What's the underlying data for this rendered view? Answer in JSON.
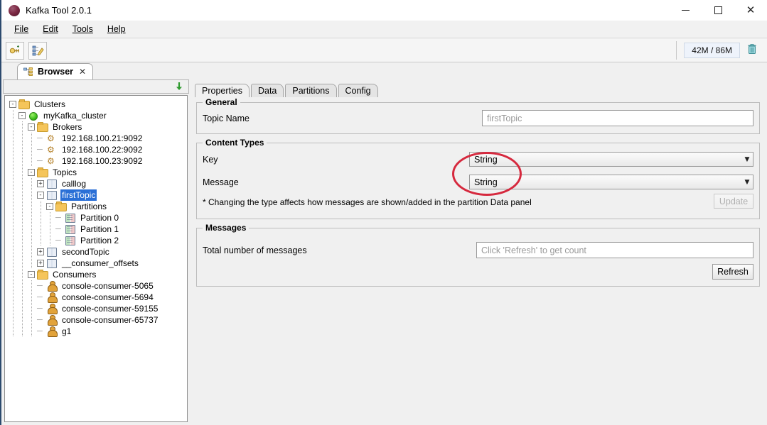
{
  "window": {
    "title": "Kafka Tool  2.0.1",
    "app_icon": "kafka-tool-logo",
    "minimize": "—",
    "maximize": "□",
    "close": "✕"
  },
  "menubar": {
    "items": [
      {
        "label": "File",
        "mnemonic": "F"
      },
      {
        "label": "Edit",
        "mnemonic": "E"
      },
      {
        "label": "Tools",
        "mnemonic": "T"
      },
      {
        "label": "Help",
        "mnemonic": "H"
      }
    ]
  },
  "toolbar": {
    "buttons": [
      {
        "name": "add-cluster-icon"
      },
      {
        "name": "edit-cluster-icon"
      }
    ],
    "memory": {
      "value": "42M / 86M",
      "trash_icon": "trash-icon"
    }
  },
  "tabstrip": {
    "browser_tab": {
      "label": "Browser",
      "icon": "browser-tree-icon",
      "close": "✕"
    }
  },
  "tree_header": {
    "collapse_icon": "green-down-arrow-icon"
  },
  "tree": {
    "nodes": [
      {
        "label": "Clusters",
        "indent": 0,
        "expander": "-",
        "icon": "folder-icon",
        "selected": false
      },
      {
        "label": "myKafka_cluster",
        "indent": 1,
        "expander": "-",
        "icon": "cluster-icon",
        "selected": false
      },
      {
        "label": "Brokers",
        "indent": 2,
        "expander": "-",
        "icon": "folder-icon",
        "selected": false
      },
      {
        "label": "192.168.100.21:9092",
        "indent": 3,
        "expander": "",
        "icon": "broker-icon",
        "selected": false
      },
      {
        "label": "192.168.100.22:9092",
        "indent": 3,
        "expander": "",
        "icon": "broker-icon",
        "selected": false
      },
      {
        "label": "192.168.100.23:9092",
        "indent": 3,
        "expander": "",
        "icon": "broker-icon",
        "selected": false
      },
      {
        "label": "Topics",
        "indent": 2,
        "expander": "-",
        "icon": "folder-icon",
        "selected": false
      },
      {
        "label": "calllog",
        "indent": 3,
        "expander": "+",
        "icon": "topic-icon",
        "selected": false
      },
      {
        "label": "firstTopic",
        "indent": 3,
        "expander": "-",
        "icon": "topic-icon",
        "selected": true
      },
      {
        "label": "Partitions",
        "indent": 4,
        "expander": "-",
        "icon": "folder-icon",
        "selected": false
      },
      {
        "label": "Partition 0",
        "indent": 5,
        "expander": "",
        "icon": "partition-icon",
        "selected": false
      },
      {
        "label": "Partition 1",
        "indent": 5,
        "expander": "",
        "icon": "partition-icon",
        "selected": false
      },
      {
        "label": "Partition 2",
        "indent": 5,
        "expander": "",
        "icon": "partition-icon",
        "selected": false
      },
      {
        "label": "secondTopic",
        "indent": 3,
        "expander": "+",
        "icon": "topic-icon",
        "selected": false
      },
      {
        "label": "__consumer_offsets",
        "indent": 3,
        "expander": "+",
        "icon": "topic-icon",
        "selected": false
      },
      {
        "label": "Consumers",
        "indent": 2,
        "expander": "-",
        "icon": "folder-icon",
        "selected": false
      },
      {
        "label": "console-consumer-5065",
        "indent": 3,
        "expander": "",
        "icon": "consumer-icon",
        "selected": false
      },
      {
        "label": "console-consumer-5694",
        "indent": 3,
        "expander": "",
        "icon": "consumer-icon",
        "selected": false
      },
      {
        "label": "console-consumer-59155",
        "indent": 3,
        "expander": "",
        "icon": "consumer-icon",
        "selected": false
      },
      {
        "label": "console-consumer-65737",
        "indent": 3,
        "expander": "",
        "icon": "consumer-icon",
        "selected": false
      },
      {
        "label": "g1",
        "indent": 3,
        "expander": "",
        "icon": "consumer-icon",
        "selected": false
      }
    ]
  },
  "content": {
    "tabs": [
      {
        "label": "Properties",
        "active": true
      },
      {
        "label": "Data",
        "active": false
      },
      {
        "label": "Partitions",
        "active": false
      },
      {
        "label": "Config",
        "active": false
      }
    ],
    "general": {
      "title": "General",
      "topic_name_label": "Topic Name",
      "topic_name_value": "firstTopic"
    },
    "content_types": {
      "title": "Content Types",
      "key_label": "Key",
      "key_value": "String",
      "message_label": "Message",
      "message_value": "String",
      "dropdown_arrow": "▼",
      "note": "* Changing the type affects how messages are shown/added in the partition Data panel",
      "update_label": "Update",
      "update_disabled": true
    },
    "messages": {
      "title": "Messages",
      "total_label": "Total number of messages",
      "total_placeholder": "Click 'Refresh' to get count",
      "refresh_label": "Refresh"
    }
  },
  "annotation": {
    "shape": "ellipse",
    "color": "#d6293e",
    "targets": [
      "key-content-type-dropdown",
      "message-content-type-dropdown"
    ]
  }
}
